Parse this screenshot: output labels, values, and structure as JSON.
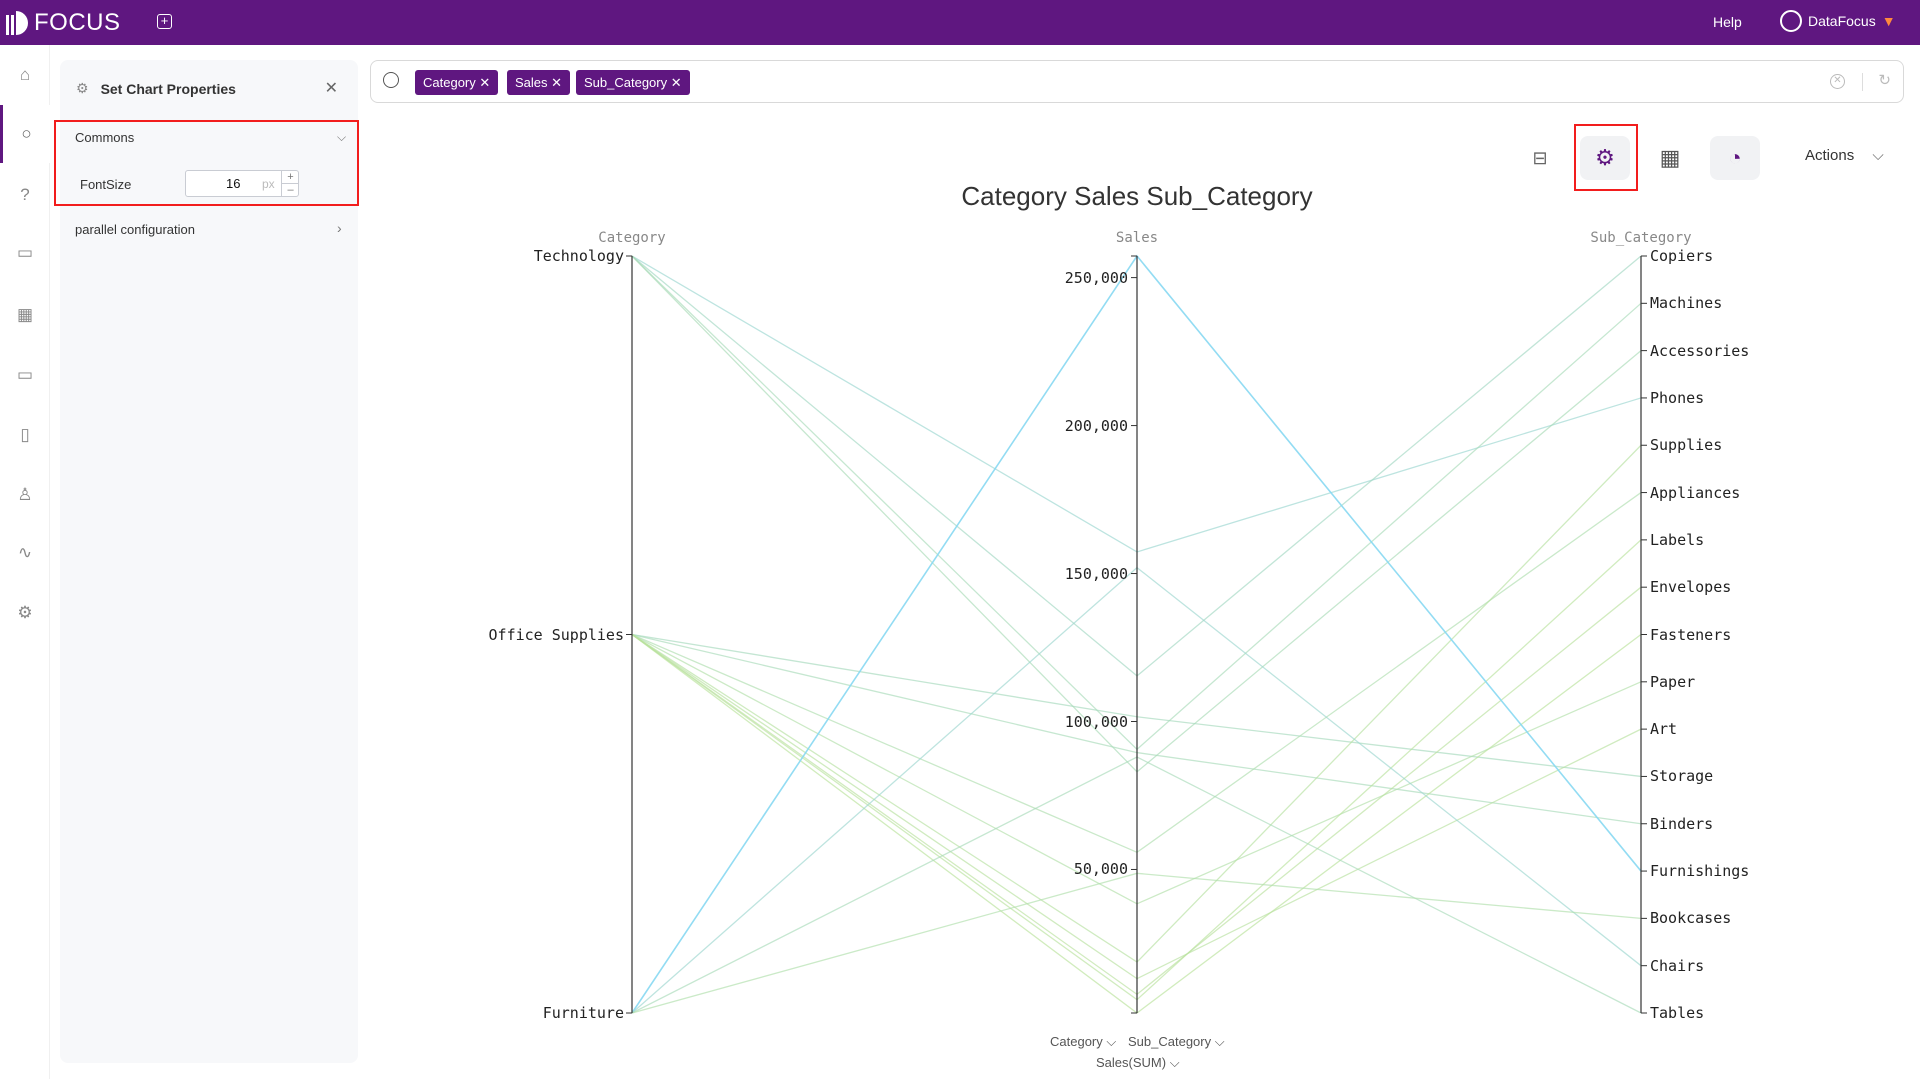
{
  "app": {
    "logo_text": "FOCUS",
    "help": "Help",
    "user": "DataFocus"
  },
  "sidebar": {
    "items": [
      {
        "icon": "home-icon"
      },
      {
        "icon": "search-icon",
        "active": true
      },
      {
        "icon": "help-icon"
      },
      {
        "icon": "dashboard-icon"
      },
      {
        "icon": "table-icon"
      },
      {
        "icon": "folder-icon"
      },
      {
        "icon": "clipboard-icon"
      },
      {
        "icon": "user-icon"
      },
      {
        "icon": "activity-icon"
      },
      {
        "icon": "settings-icon"
      }
    ]
  },
  "panel": {
    "title": "Set Chart Properties",
    "commons": "Commons",
    "fontsize_label": "FontSize",
    "fontsize_value": "16",
    "fontsize_unit": "px",
    "parallel": "parallel configuration"
  },
  "search": {
    "chips": [
      "Category",
      "Sales",
      "Sub_Category"
    ]
  },
  "toolbar": {
    "actions": "Actions"
  },
  "colors": {
    "brand": "#5f1780",
    "highlight": "#f21d1d",
    "line_low": "#b9e29a",
    "line_mid": "#9fd6c6",
    "line_high": "#87d8f2"
  },
  "chart_data": {
    "type": "parallel",
    "title": "Category Sales Sub_Category",
    "axes": [
      {
        "name": "Category",
        "type": "category",
        "categories": [
          "Technology",
          "Office Supplies",
          "Furniture"
        ]
      },
      {
        "name": "Sales",
        "type": "value",
        "range": [
          1500,
          257300
        ],
        "ticks": [
          50000,
          100000,
          150000,
          200000,
          250000
        ],
        "tick_labels": [
          "50,000",
          "100,000",
          "150,000",
          "200,000",
          "250,000"
        ]
      },
      {
        "name": "Sub_Category",
        "type": "category",
        "categories": [
          "Copiers",
          "Machines",
          "Accessories",
          "Phones",
          "Supplies",
          "Appliances",
          "Labels",
          "Envelopes",
          "Fasteners",
          "Paper",
          "Art",
          "Storage",
          "Binders",
          "Furnishings",
          "Bookcases",
          "Chairs",
          "Tables"
        ]
      }
    ],
    "rows": [
      [
        "Technology",
        157300,
        "Phones"
      ],
      [
        "Technology",
        115400,
        "Copiers"
      ],
      [
        "Technology",
        90600,
        "Machines"
      ],
      [
        "Technology",
        83000,
        "Accessories"
      ],
      [
        "Office Supplies",
        101600,
        "Storage"
      ],
      [
        "Office Supplies",
        89500,
        "Binders"
      ],
      [
        "Office Supplies",
        55800,
        "Appliances"
      ],
      [
        "Office Supplies",
        38400,
        "Paper"
      ],
      [
        "Office Supplies",
        18700,
        "Supplies"
      ],
      [
        "Office Supplies",
        13100,
        "Art"
      ],
      [
        "Office Supplies",
        7800,
        "Envelopes"
      ],
      [
        "Office Supplies",
        6000,
        "Labels"
      ],
      [
        "Office Supplies",
        1500,
        "Fasteners"
      ],
      [
        "Furniture",
        257300,
        "Furnishings"
      ],
      [
        "Furniture",
        152000,
        "Chairs"
      ],
      [
        "Furniture",
        88000,
        "Tables"
      ],
      [
        "Furniture",
        48700,
        "Bookcases"
      ]
    ]
  },
  "dropdowns": {
    "category": "Category",
    "sub_category": "Sub_Category",
    "sales": "Sales(SUM)"
  }
}
